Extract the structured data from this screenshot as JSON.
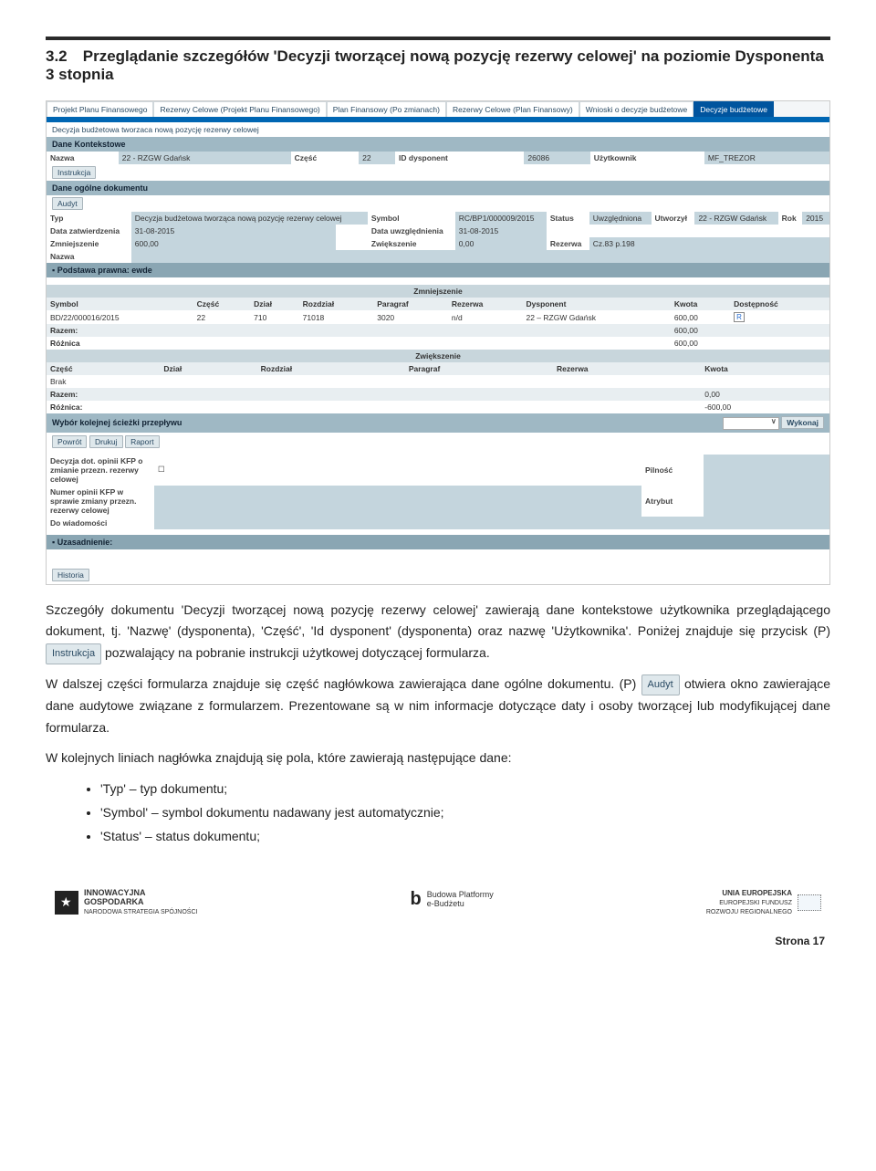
{
  "heading": {
    "num": "3.2",
    "title": "Przeglądanie szczegółów 'Decyzji tworzącej nową pozycję rezerwy celowej' na poziomie Dysponenta 3 stopnia"
  },
  "screenshot": {
    "tabs": [
      "Projekt Planu Finansowego",
      "Rezerwy Celowe (Projekt Planu Finansowego)",
      "Plan Finansowy (Po zmianach)",
      "Rezerwy Celowe (Plan Finansowy)",
      "Wnioski o decyzje budżetowe",
      "Decyzje budżetowe"
    ],
    "breadcrumb": "Decyzja budżetowa tworzaca nową pozycję rezerwy celowej",
    "sec_dane_kontekstowe": "Dane Kontekstowe",
    "kontekst": {
      "nazwa_l": "Nazwa",
      "nazwa_v": "22 - RZGW Gdańsk",
      "czesc_l": "Część",
      "czesc_v": "22",
      "id_l": "ID dysponent",
      "id_v": "26086",
      "uzytk_l": "Użytkownik",
      "uzytk_v": "MF_TREZOR"
    },
    "btn_instrukcja": "Instrukcja",
    "sec_dane_ogolne": "Dane ogólne dokumentu",
    "btn_audyt": "Audyt",
    "ogolne": {
      "typ_l": "Typ",
      "typ_v": "Decyzja budżetowa tworząca nową pozycję rezerwy celowej",
      "symbol_l": "Symbol",
      "symbol_v": "RC/BP1/000009/2015",
      "status_l": "Status",
      "status_v": "Uwzględniona",
      "utworzyl_l": "Utworzył",
      "utworzyl_v": "22 - RZGW Gdańsk",
      "rok_l": "Rok",
      "rok_v": "2015",
      "data_zatw_l": "Data zatwierdzenia",
      "data_zatw_v": "31-08-2015",
      "data_uwz_l": "Data uwzględnienia",
      "data_uwz_v": "31-08-2015",
      "zmn_l": "Zmniejszenie",
      "zmn_v": "600,00",
      "zwiek_l": "Zwiększenie",
      "zwiek_v": "0,00",
      "rezerwa_l": "Rezerwa",
      "rezerwa_v": "Cz.83 p.198",
      "nazwa_l": "Nazwa"
    },
    "podstawa": "Podstawa prawna: ewde",
    "zmn_hdr": "Zmniejszenie",
    "zmn_cols": {
      "symbol": "Symbol",
      "czesc": "Część",
      "dzial": "Dział",
      "rozdzial": "Rozdział",
      "paragraf": "Paragraf",
      "rezerwa": "Rezerwa",
      "dysp": "Dysponent",
      "kwota": "Kwota",
      "dostep": "Dostępność"
    },
    "zmn_row": {
      "symbol": "BD/22/000016/2015",
      "czesc": "22",
      "dzial": "710",
      "rozdzial": "71018",
      "paragraf": "3020",
      "rezerwa": "n/d",
      "dysp": "22 – RZGW Gdańsk",
      "kwota": "600,00",
      "r": "R"
    },
    "razem_l": "Razem:",
    "zmn_razem": "600,00",
    "roznica_l": "Różnica",
    "zmn_roznica": "600,00",
    "zwiek_hdr": "Zwiększenie",
    "zwiek_cols": {
      "czesc": "Część",
      "dzial": "Dział",
      "rozdzial": "Rozdział",
      "paragraf": "Paragraf",
      "rezerwa": "Rezerwa",
      "kwota": "Kwota"
    },
    "brak": "Brak",
    "zwiek_razem": "0,00",
    "roznica2_l": "Różnica:",
    "zwiek_roznica": "-600,00",
    "wybor": "Wybór kolejnej ścieżki przepływu",
    "wykonaj": "Wykonaj",
    "powrot": "Powrót",
    "drukuj": "Drukuj",
    "raport": "Raport",
    "dec_opinii": "Decyzja dot. opinii KFP o zmianie przezn. rezerwy celowej",
    "numer_opinii": "Numer opinii KFP w sprawie zmiany przezn. rezerwy celowej",
    "do_wiad": "Do wiadomości",
    "pilnosc": "Pilność",
    "atrybut": "Atrybut",
    "uzasadnienie": "Uzasadnienie:",
    "historia": "Historia"
  },
  "paras": {
    "p1a": "Szczegóły dokumentu 'Decyzji tworzącej nową pozycję rezerwy celowej' zawierają dane kontekstowe użytkownika przeglądającego dokument, tj. 'Nazwę' (dysponenta), 'Część', 'Id dysponent' (dysponenta) oraz nazwę 'Użytkownika'. Poniżej znajduje się przycisk (P) ",
    "p1btn": "Instrukcja",
    "p1b": " pozwalający na pobranie instrukcji użytkowej dotyczącej formularza.",
    "p2a": "W dalszej części formularza znajduje się część nagłówkowa zawierająca dane ogólne dokumentu. (P) ",
    "p2btn": "Audyt",
    "p2b": " otwiera okno zawierające dane audytowe związane z formularzem. Prezentowane są w nim informacje dotyczące daty i osoby tworzącej lub modyfikującej dane formularza.",
    "p3": "W kolejnych liniach nagłówka znajdują się pola, które zawierają następujące dane:"
  },
  "bullets": {
    "b1": "'Typ' – typ dokumentu;",
    "b2": "'Symbol' – symbol dokumentu nadawany jest automatycznie;",
    "b3": "'Status' – status dokumentu;"
  },
  "footer": {
    "logo1a": "INNOWACYJNA",
    "logo1b": "GOSPODARKA",
    "logo1c": "NARODOWA STRATEGIA SPÓJNOŚCI",
    "logo2a": "Budowa Platformy",
    "logo2b": "e-Budżetu",
    "logo3a": "UNIA EUROPEJSKA",
    "logo3b": "EUROPEJSKI FUNDUSZ",
    "logo3c": "ROZWOJU REGIONALNEGO",
    "page": "Strona 17"
  }
}
